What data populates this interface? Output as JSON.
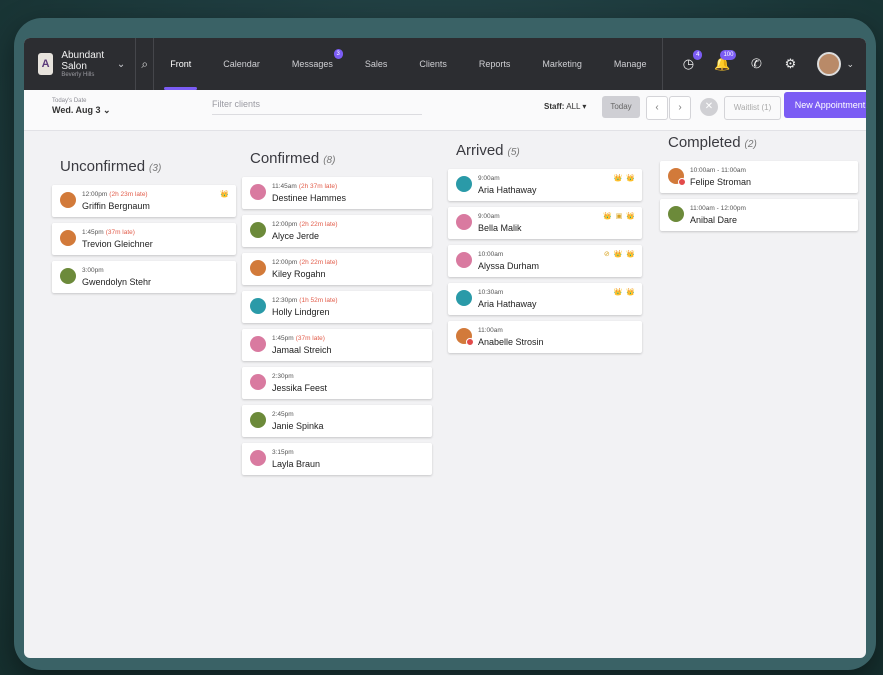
{
  "nav": {
    "salon_name": "Abundant Salon",
    "salon_location": "Beverly Hills",
    "logo_letter": "A",
    "tabs": [
      {
        "label": "Front Desk",
        "active": true
      },
      {
        "label": "Calendar"
      },
      {
        "label": "Messages",
        "badge": "3"
      },
      {
        "label": "Sales"
      },
      {
        "label": "Clients"
      },
      {
        "label": "Reports"
      },
      {
        "label": "Marketing"
      },
      {
        "label": "Manage"
      }
    ],
    "clock_badge": "4",
    "bell_badge": "100"
  },
  "subbar": {
    "date_label": "Today's Date",
    "date_value": "Wed. Aug 3",
    "filter_placeholder": "Filter clients",
    "staff_label": "Staff:",
    "staff_value": "ALL",
    "today_button": "Today",
    "waitlist_button": "Waitlist (1)",
    "new_appointment_button": "New Appointment"
  },
  "columns": [
    {
      "title": "Unconfirmed",
      "count": "(3)",
      "cards": [
        {
          "time": "12:00pm",
          "late": "(2h 23m late)",
          "name": "Griffin Bergnaum",
          "avatar": "orange",
          "icons": "👑"
        },
        {
          "time": "1:45pm",
          "late": "(37m late)",
          "name": "Trevion Gleichner",
          "avatar": "orange",
          "icons": ""
        },
        {
          "time": "3:00pm",
          "late": "",
          "name": "Gwendolyn Stehr",
          "avatar": "olive",
          "icons": ""
        }
      ]
    },
    {
      "title": "Confirmed",
      "count": "(8)",
      "cards": [
        {
          "time": "11:45am",
          "late": "(2h 37m late)",
          "name": "Destinee Hammes",
          "avatar": "pink",
          "icons": ""
        },
        {
          "time": "12:00pm",
          "late": "(2h 22m late)",
          "name": "Alyce Jerde",
          "avatar": "olive",
          "icons": ""
        },
        {
          "time": "12:00pm",
          "late": "(2h 22m late)",
          "name": "Kiley Rogahn",
          "avatar": "orange",
          "icons": ""
        },
        {
          "time": "12:30pm",
          "late": "(1h 52m late)",
          "name": "Holly Lindgren",
          "avatar": "teal",
          "icons": ""
        },
        {
          "time": "1:45pm",
          "late": "(37m late)",
          "name": "Jamaal Streich",
          "avatar": "pink",
          "icons": ""
        },
        {
          "time": "2:30pm",
          "late": "",
          "name": "Jessika Feest",
          "avatar": "pink",
          "icons": ""
        },
        {
          "time": "2:45pm",
          "late": "",
          "name": "Janie Spinka",
          "avatar": "olive",
          "icons": ""
        },
        {
          "time": "3:15pm",
          "late": "",
          "name": "Layla Braun",
          "avatar": "pink",
          "icons": ""
        }
      ]
    },
    {
      "title": "Arrived",
      "count": "(5)",
      "cards": [
        {
          "time": "9:00am",
          "late": "",
          "name": "Aria Hathaway",
          "avatar": "teal",
          "icons": "👑 👑"
        },
        {
          "time": "9:00am",
          "late": "",
          "name": "Bella Malik",
          "avatar": "pink",
          "icons": "👑 ▣ 👑"
        },
        {
          "time": "10:00am",
          "late": "",
          "name": "Alyssa Durham",
          "avatar": "pink",
          "icons": "⊘ 👑 👑"
        },
        {
          "time": "10:30am",
          "late": "",
          "name": "Aria Hathaway",
          "avatar": "teal",
          "icons": "👑 👑"
        },
        {
          "time": "11:00am",
          "late": "",
          "name": "Anabelle Strosin",
          "avatar": "orange",
          "notice": true,
          "icons": ""
        }
      ]
    },
    {
      "title": "Completed",
      "count": "(2)",
      "cards": [
        {
          "time": "10:00am - 11:00am",
          "late": "",
          "name": "Felipe Stroman",
          "avatar": "orange",
          "notice": true,
          "icons": ""
        },
        {
          "time": "11:00am - 12:00pm",
          "late": "",
          "name": "Anibal Dare",
          "avatar": "olive",
          "icons": ""
        }
      ]
    }
  ],
  "colors": {
    "accent": "#7b5cf4",
    "late": "#e25c4a",
    "nav_bg": "#2c2d31"
  }
}
